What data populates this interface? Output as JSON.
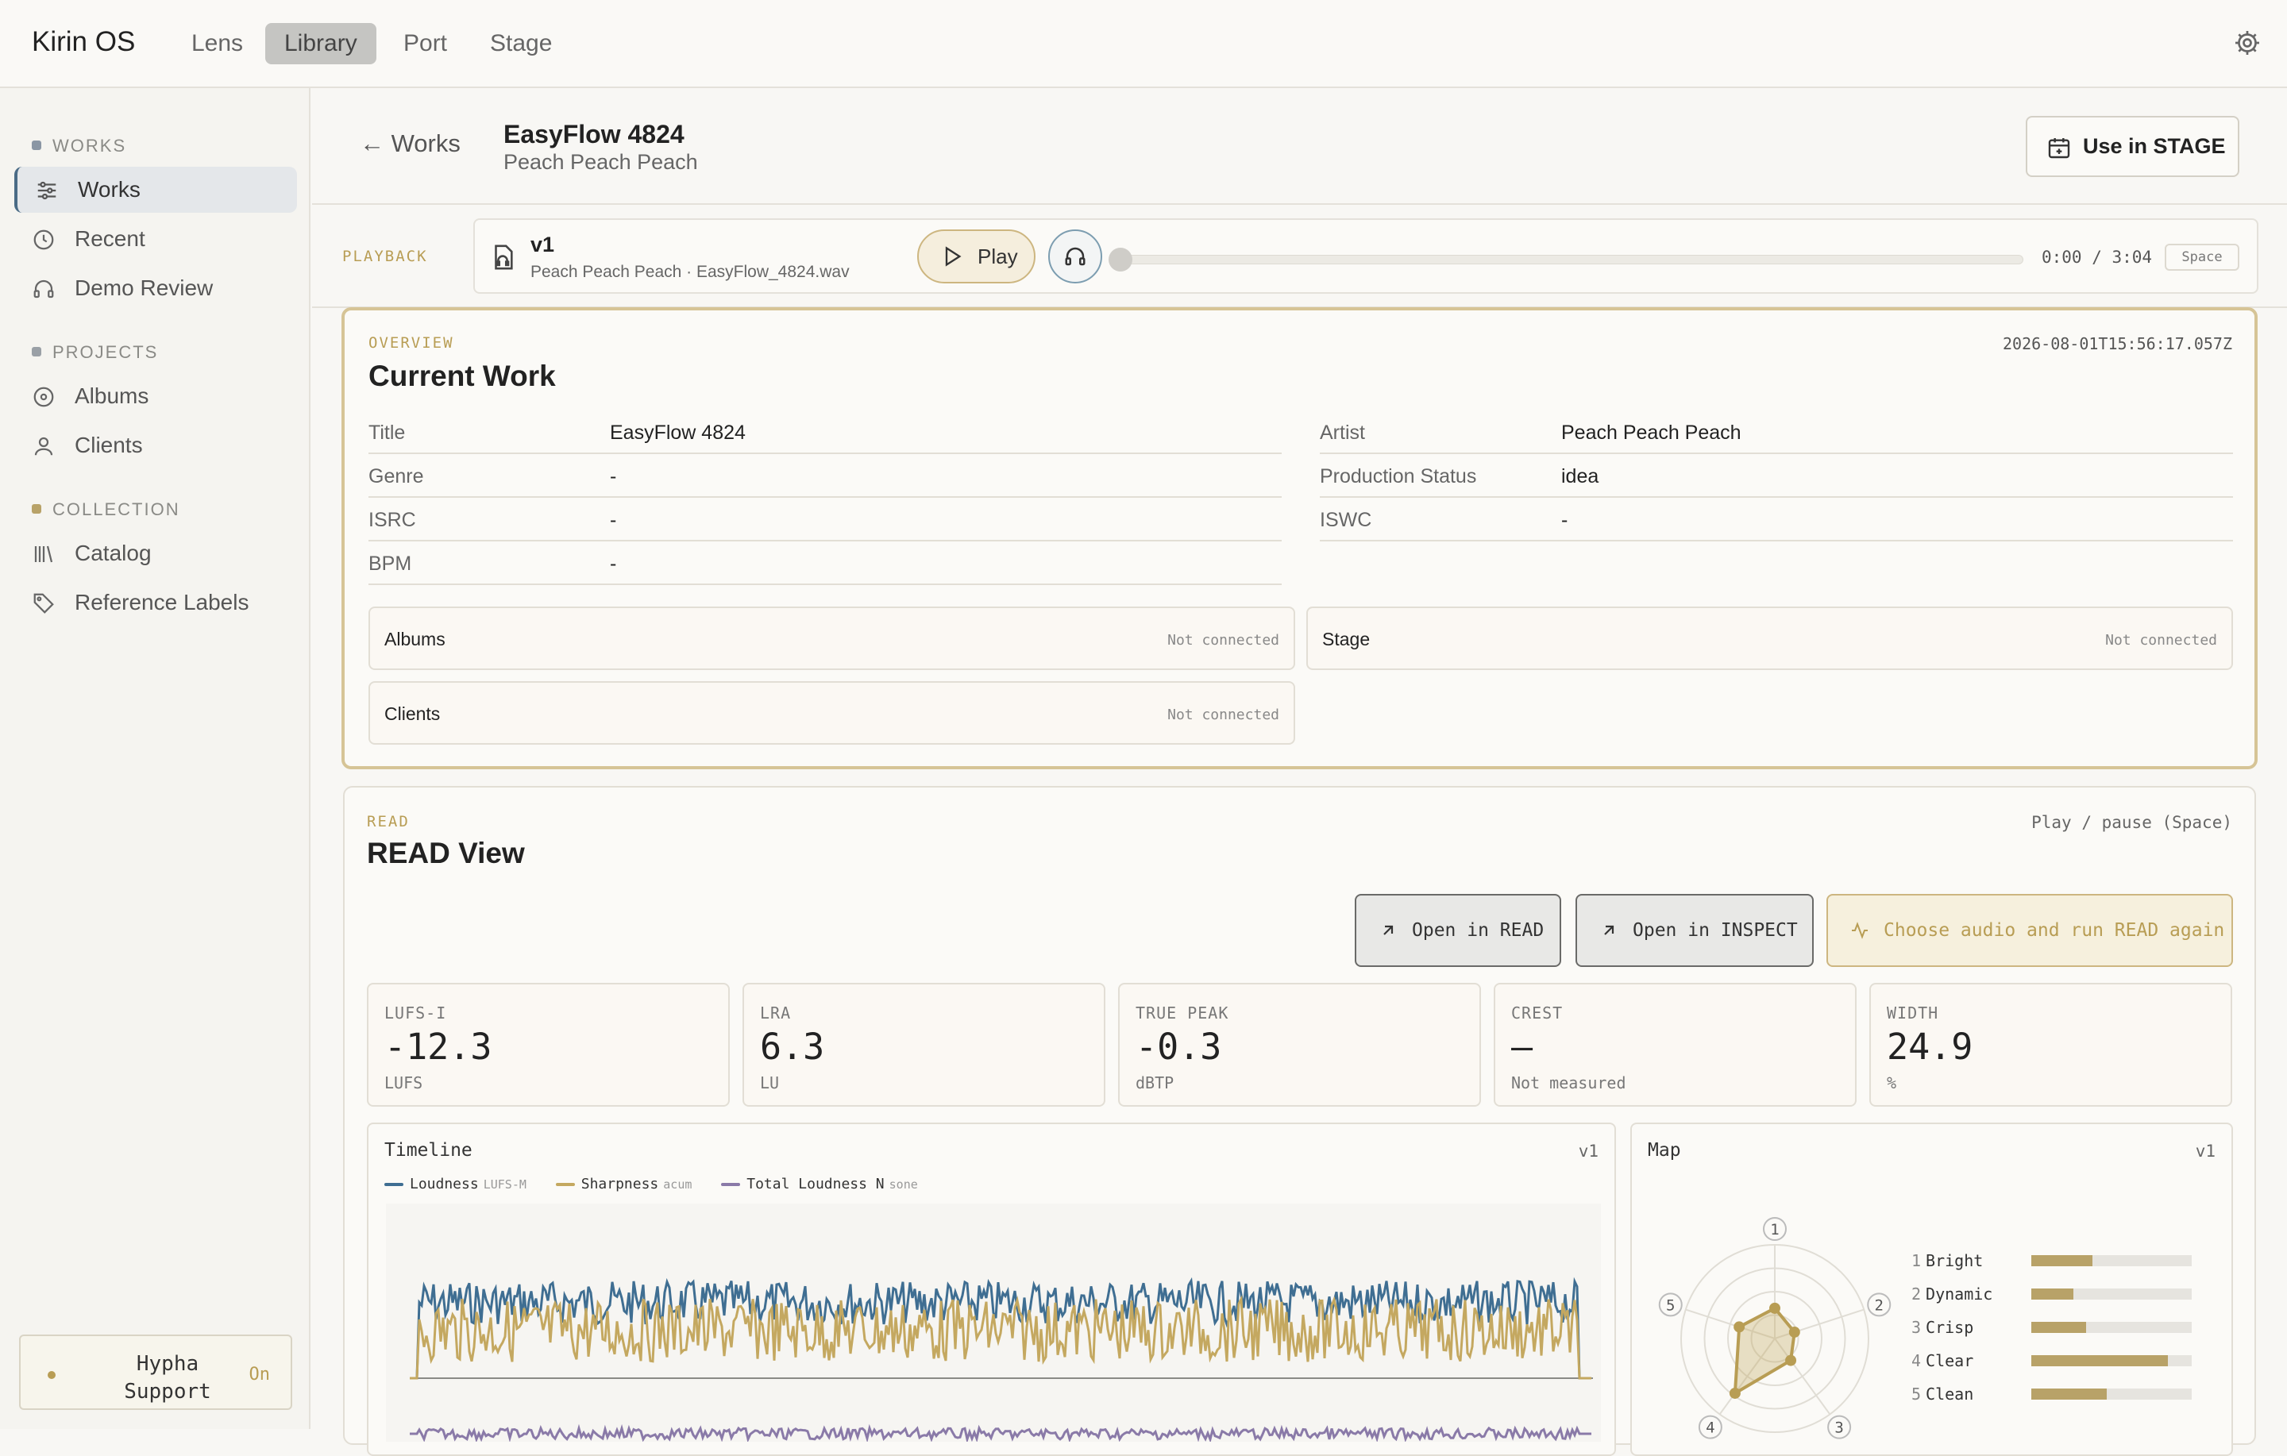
{
  "app": {
    "brand": "Kirin OS",
    "nav": [
      "Lens",
      "Library",
      "Port",
      "Stage"
    ],
    "active_nav": "Library"
  },
  "sidebar": {
    "sections": [
      {
        "title": "WORKS",
        "color": "#8a96a4",
        "items": [
          {
            "label": "Works",
            "icon": "sliders-icon",
            "active": true
          },
          {
            "label": "Recent",
            "icon": "clock-icon"
          },
          {
            "label": "Demo Review",
            "icon": "headphones-icon"
          }
        ]
      },
      {
        "title": "PROJECTS",
        "color": "#9aa0a6",
        "items": [
          {
            "label": "Albums",
            "icon": "disc-icon"
          },
          {
            "label": "Clients",
            "icon": "user-icon"
          }
        ]
      },
      {
        "title": "COLLECTION",
        "color": "#b8a268",
        "items": [
          {
            "label": "Catalog",
            "icon": "library-icon"
          },
          {
            "label": "Reference Labels",
            "icon": "tag-icon"
          }
        ]
      }
    ],
    "support": {
      "label": "Hypha Support",
      "state": "On"
    }
  },
  "header": {
    "back": "← Works",
    "title": "EasyFlow 4824",
    "subtitle": "Peach Peach Peach",
    "action": "Use in STAGE"
  },
  "playback": {
    "label": "PLAYBACK",
    "version": "v1",
    "file": "Peach Peach Peach · EasyFlow_4824.wav",
    "play_label": "Play",
    "time": "0:00 / 3:04",
    "shortcut": "Space",
    "progress": 0
  },
  "overview": {
    "tag": "OVERVIEW",
    "title": "Current Work",
    "timestamp": "2026-08-01T15:56:17.057Z",
    "left_fields": [
      {
        "k": "Title",
        "v": "EasyFlow 4824"
      },
      {
        "k": "Genre",
        "v": "-"
      },
      {
        "k": "ISRC",
        "v": "-"
      },
      {
        "k": "BPM",
        "v": "-"
      }
    ],
    "right_fields": [
      {
        "k": "Artist",
        "v": "Peach Peach Peach"
      },
      {
        "k": "Production Status",
        "v": "idea"
      },
      {
        "k": "ISWC",
        "v": "-"
      }
    ],
    "connections": [
      {
        "k": "Albums",
        "s": "Not connected"
      },
      {
        "k": "Stage",
        "s": "Not connected"
      },
      {
        "k": "Clients",
        "s": "Not connected"
      }
    ]
  },
  "read": {
    "tag": "READ",
    "title": "READ View",
    "hint": "Play / pause (Space)",
    "buttons": [
      "Open in READ",
      "Open in INSPECT",
      "Choose audio and run READ again"
    ],
    "metrics": [
      {
        "label": "LUFS-I",
        "value": "-12.3",
        "unit": "LUFS"
      },
      {
        "label": "LRA",
        "value": "6.3",
        "unit": "LU"
      },
      {
        "label": "TRUE PEAK",
        "value": "-0.3",
        "unit": "dBTP"
      },
      {
        "label": "CREST",
        "value": "—",
        "unit": "Not measured"
      },
      {
        "label": "WIDTH",
        "value": "24.9",
        "unit": "%"
      }
    ],
    "timeline": {
      "title": "Timeline",
      "version": "v1",
      "legend": [
        {
          "name": "Loudness",
          "unit": "LUFS-M",
          "color": "#3f6e92"
        },
        {
          "name": "Sharpness",
          "unit": "acum",
          "color": "#c4a860"
        },
        {
          "name": "Total Loudness N",
          "unit": "sone",
          "color": "#8a7aa8"
        }
      ]
    },
    "map": {
      "title": "Map",
      "version": "v1",
      "axes": [
        "1",
        "2",
        "3",
        "4",
        "5"
      ],
      "items": [
        {
          "n": "1",
          "label": "Bright",
          "value": 0.38
        },
        {
          "n": "2",
          "label": "Dynamic",
          "value": 0.26
        },
        {
          "n": "3",
          "label": "Crisp",
          "value": 0.34
        },
        {
          "n": "4",
          "label": "Clear",
          "value": 0.85
        },
        {
          "n": "5",
          "label": "Clean",
          "value": 0.47
        }
      ]
    }
  }
}
